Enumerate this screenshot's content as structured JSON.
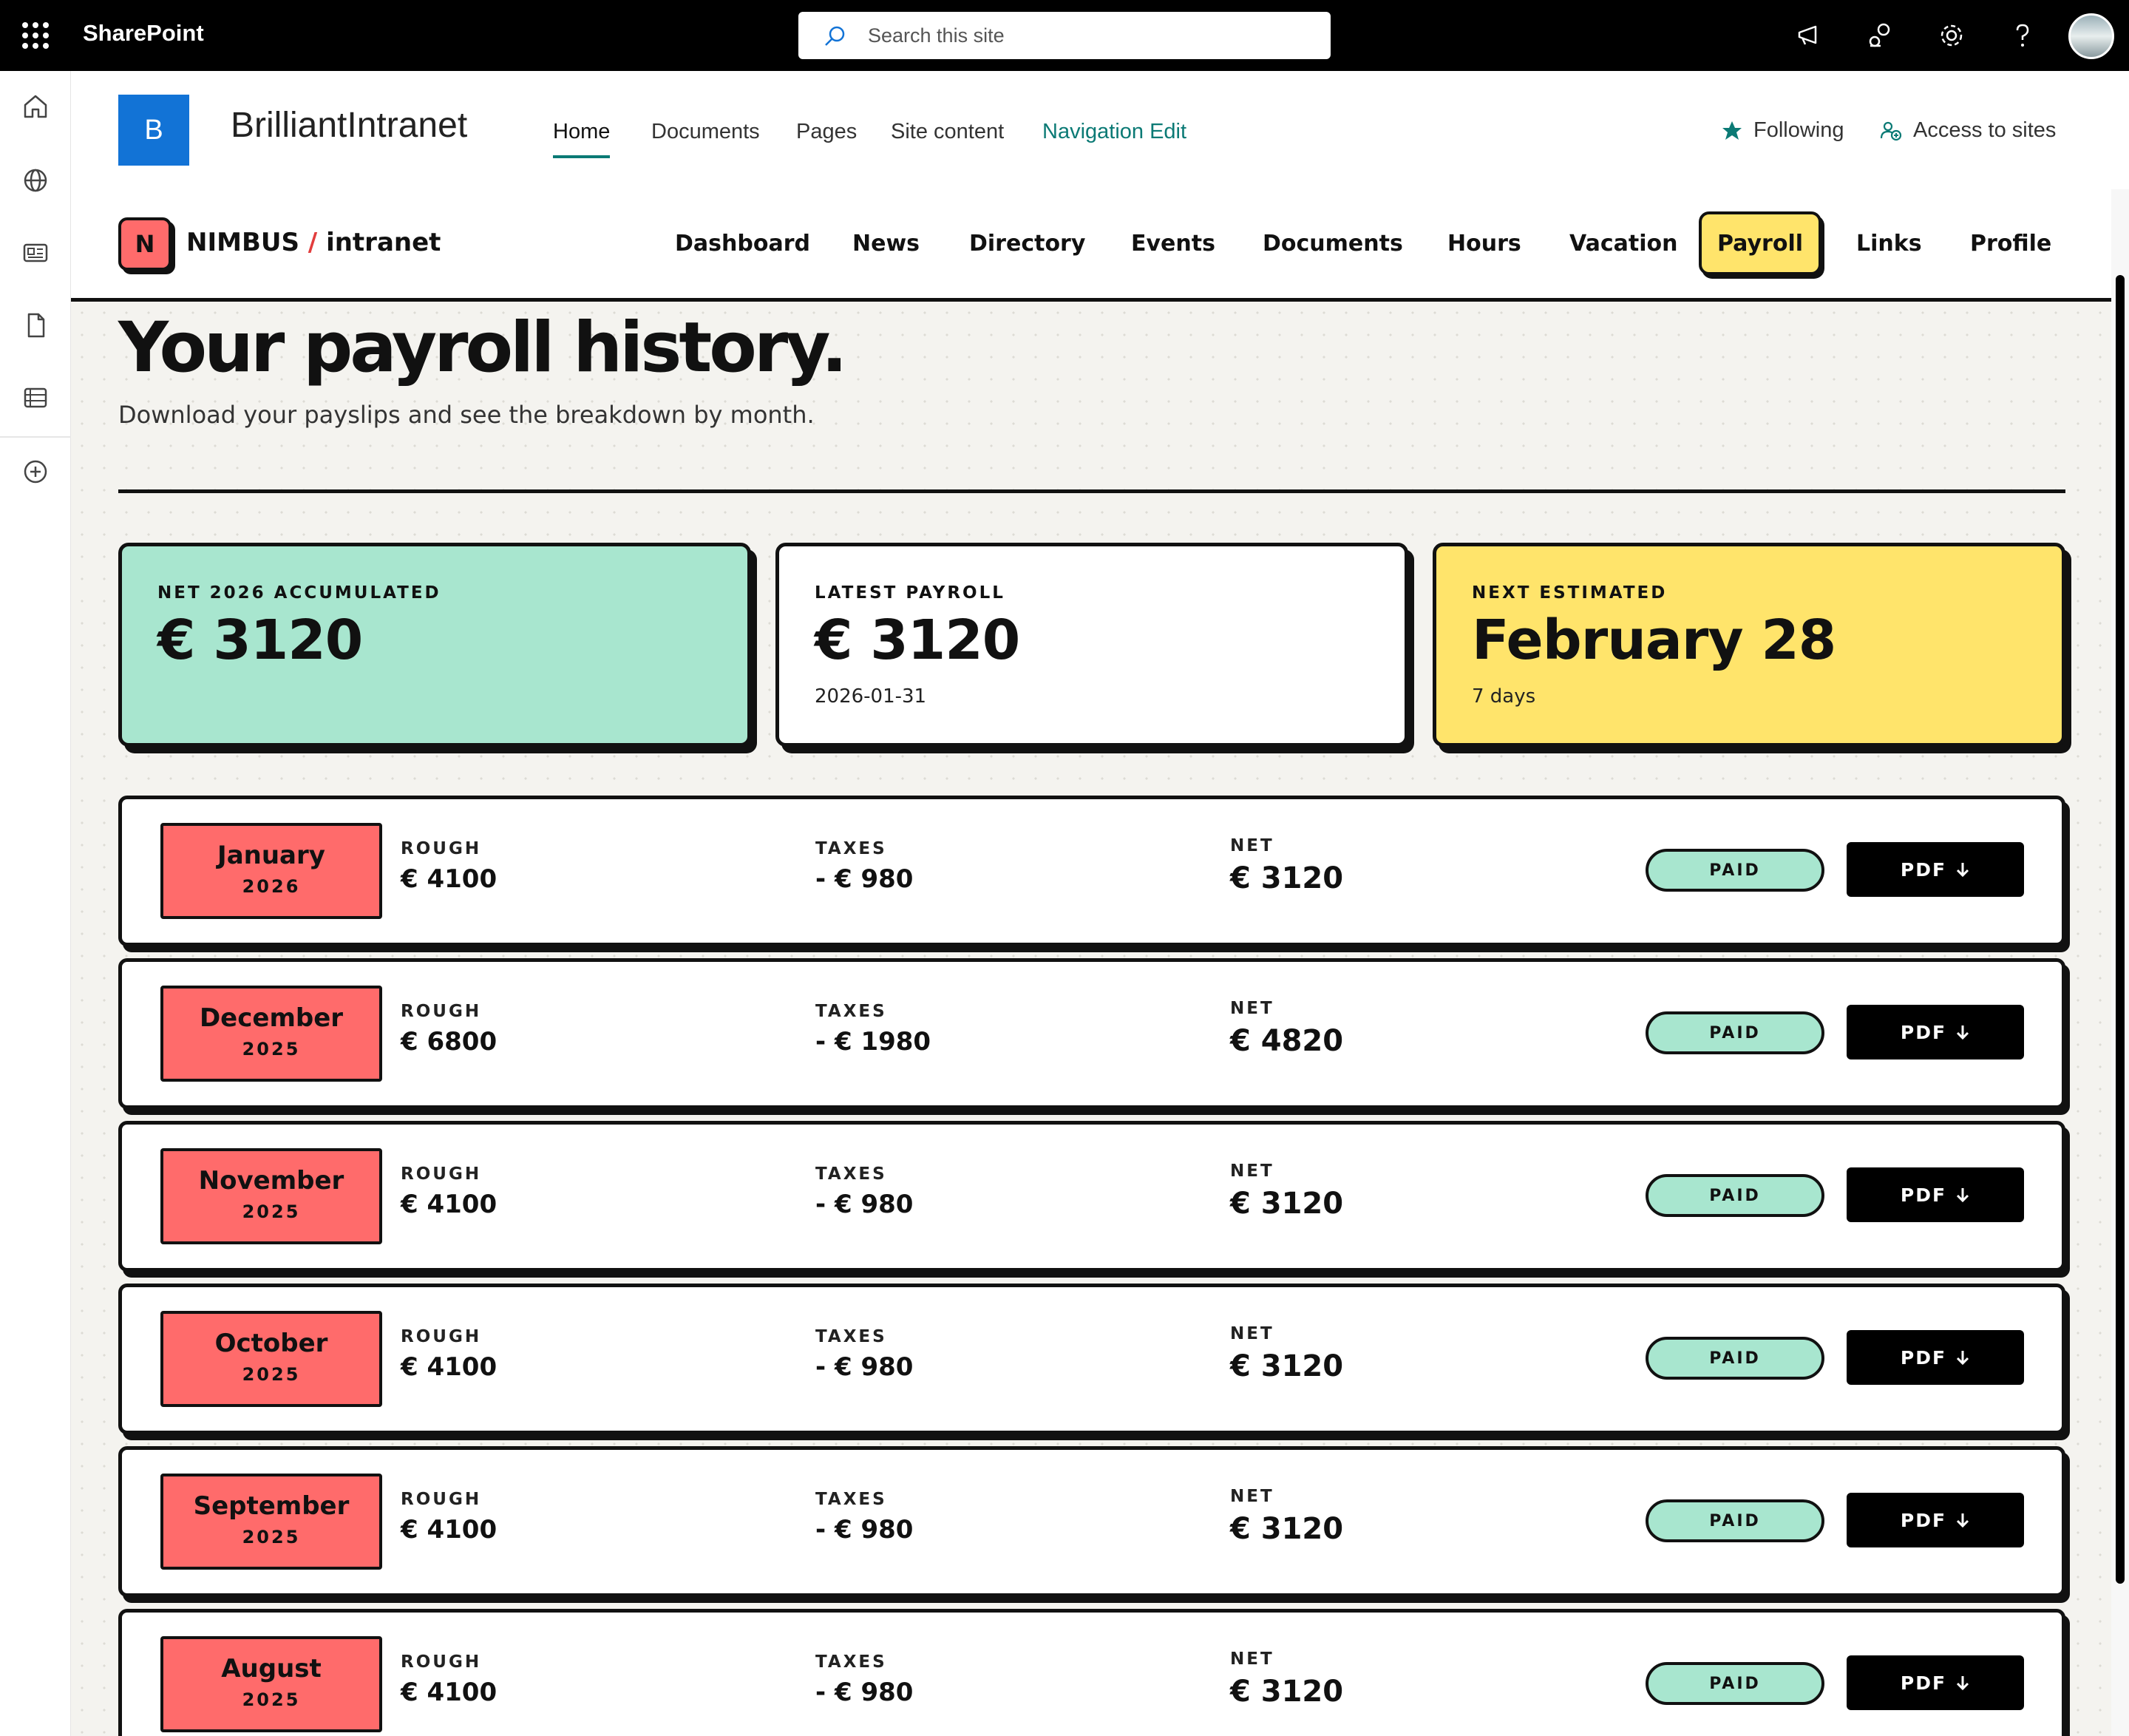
{
  "suitebar": {
    "app_name": "SharePoint",
    "search_placeholder": "Search this site"
  },
  "site": {
    "logo_letter": "B",
    "title": "BrilliantIntranet",
    "nav": [
      "Home",
      "Documents",
      "Pages",
      "Site content",
      "Navigation Edit"
    ],
    "following_label": "Following",
    "access_label": "Access to sites"
  },
  "nimbus": {
    "logo_letter": "N",
    "brand_a": "NIMBUS",
    "brand_sep": "/",
    "brand_b": "intranet",
    "nav": [
      "Dashboard",
      "News",
      "Directory",
      "Events",
      "Documents",
      "Hours",
      "Vacation",
      "Payroll",
      "Links",
      "Profile"
    ],
    "active": "Payroll"
  },
  "page": {
    "title": "Your payroll history.",
    "subtitle": "Download your payslips and see the breakdown by month."
  },
  "cards": [
    {
      "label": "NET 2026 ACCUMULATED",
      "value": "€ 3120",
      "note": "",
      "color": "#a8e6cf"
    },
    {
      "label": "LATEST PAYROLL",
      "value": "€ 3120",
      "note": "2026-01-31",
      "color": "#ffffff"
    },
    {
      "label": "NEXT ESTIMATED",
      "value": "February 28",
      "note": "7 days",
      "color": "#ffe46b"
    }
  ],
  "columns": {
    "rough": "ROUGH",
    "taxes": "TAXES",
    "net": "NET"
  },
  "rows": [
    {
      "month": "January",
      "year": "2026",
      "rough": "€ 4100",
      "taxes": "- € 980",
      "net": "€ 3120",
      "status": "PAID",
      "pdf": "PDF"
    },
    {
      "month": "December",
      "year": "2025",
      "rough": "€ 6800",
      "taxes": "- € 1980",
      "net": "€ 4820",
      "status": "PAID",
      "pdf": "PDF"
    },
    {
      "month": "November",
      "year": "2025",
      "rough": "€ 4100",
      "taxes": "- € 980",
      "net": "€ 3120",
      "status": "PAID",
      "pdf": "PDF"
    },
    {
      "month": "October",
      "year": "2025",
      "rough": "€ 4100",
      "taxes": "- € 980",
      "net": "€ 3120",
      "status": "PAID",
      "pdf": "PDF"
    },
    {
      "month": "September",
      "year": "2025",
      "rough": "€ 4100",
      "taxes": "- € 980",
      "net": "€ 3120",
      "status": "PAID",
      "pdf": "PDF"
    },
    {
      "month": "August",
      "year": "2025",
      "rough": "€ 4100",
      "taxes": "- € 980",
      "net": "€ 3120",
      "status": "PAID",
      "pdf": "PDF"
    }
  ],
  "colors": {
    "accent_teal": "#0b7a75",
    "sharepoint_blue": "#1273d6",
    "month_badge": "#ff6b6b",
    "paid_badge": "#a8e6cf",
    "payroll_tab": "#ffe46b"
  },
  "icons": {
    "suite": [
      "app-launcher-icon",
      "search-icon",
      "megaphone-icon",
      "share-settings-icon",
      "gear-icon",
      "help-icon"
    ],
    "rail": [
      "home-icon",
      "globe-icon",
      "news-icon",
      "file-icon",
      "list-icon",
      "add-icon"
    ],
    "header": [
      "star-icon",
      "people-icon"
    ],
    "row": [
      "arrow-down-icon"
    ]
  }
}
